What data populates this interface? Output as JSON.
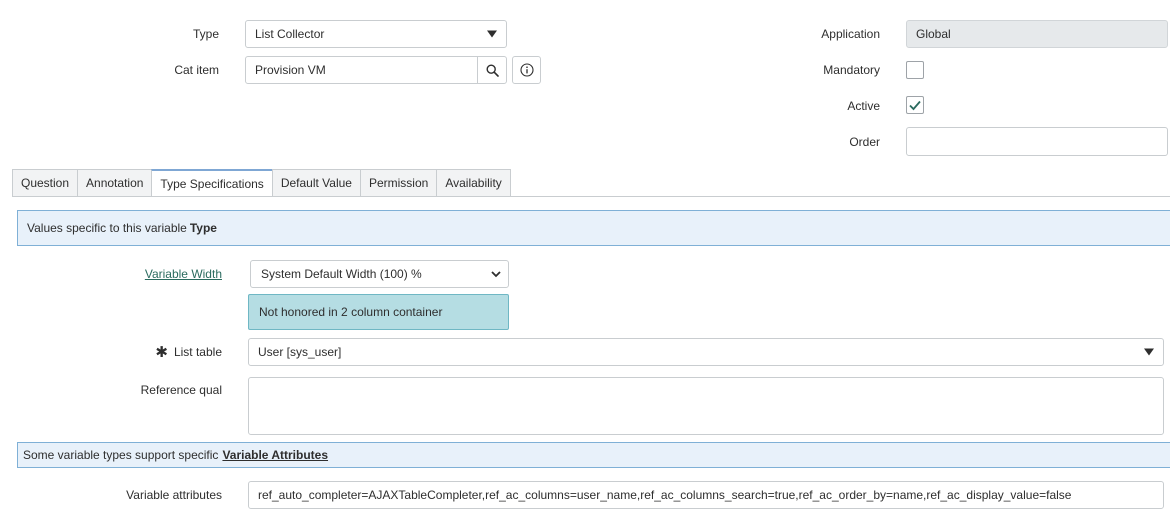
{
  "form": {
    "type": {
      "label": "Type",
      "value": "List Collector"
    },
    "cat_item": {
      "label": "Cat item",
      "value": "Provision VM"
    },
    "application": {
      "label": "Application",
      "value": "Global"
    },
    "mandatory": {
      "label": "Mandatory",
      "checked": false
    },
    "active": {
      "label": "Active",
      "checked": true
    },
    "order": {
      "label": "Order",
      "value": ""
    }
  },
  "tabs": [
    {
      "label": "Question",
      "active": false
    },
    {
      "label": "Annotation",
      "active": false
    },
    {
      "label": "Type Specifications",
      "active": true
    },
    {
      "label": "Default Value",
      "active": false
    },
    {
      "label": "Permission",
      "active": false
    },
    {
      "label": "Availability",
      "active": false
    }
  ],
  "type_spec": {
    "banner_text": "Values specific to this variable",
    "banner_bold": "Type",
    "variable_width": {
      "label": "Variable Width",
      "value": "System Default Width (100) %",
      "note": "Not honored in 2 column container"
    },
    "list_table": {
      "required_marker": "✱",
      "label": "List table",
      "value": "User [sys_user]"
    },
    "reference_qual": {
      "label": "Reference qual",
      "value": ""
    },
    "attributes_banner_text": "Some variable types support specific",
    "attributes_banner_link": "Variable Attributes",
    "variable_attributes": {
      "label": "Variable attributes",
      "value": "ref_auto_completer=AJAXTableCompleter,ref_ac_columns=user_name,ref_ac_columns_search=true,ref_ac_order_by=name,ref_ac_display_value=false"
    }
  },
  "icons": {
    "search": "search-icon",
    "info": "info-icon",
    "check": "check-icon",
    "dropdown": "chevron-down-icon"
  },
  "colors": {
    "banner_bg": "#e8f1fa",
    "banner_border": "#7fb0d6",
    "note_bg": "#b5dde3",
    "link": "#2b6b5f",
    "check": "#2b6b5f"
  }
}
